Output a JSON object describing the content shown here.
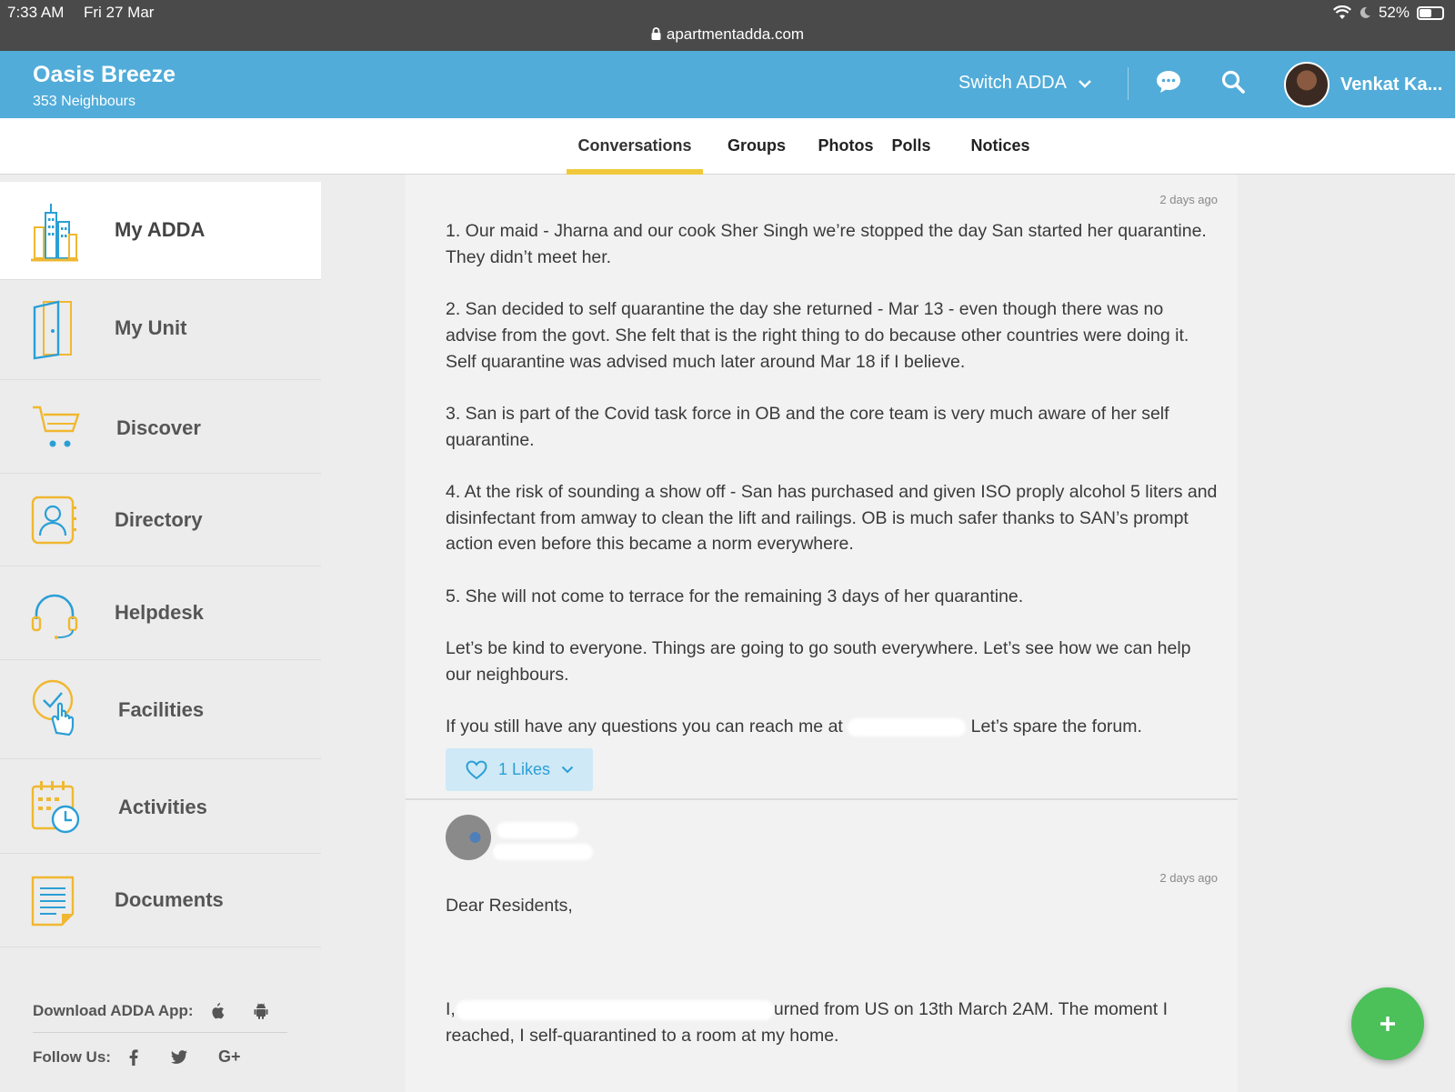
{
  "status_bar": {
    "time": "7:33 AM",
    "date": "Fri 27 Mar",
    "battery": "52%",
    "url": "apartmentadda.com"
  },
  "header": {
    "community_name": "Oasis Breeze",
    "neighbours": "353 Neighbours",
    "switch_label": "Switch ADDA",
    "user_name": "Venkat Ka..."
  },
  "tabs": [
    {
      "label": "Conversations",
      "active": true
    },
    {
      "label": "Groups"
    },
    {
      "label": "Photos"
    },
    {
      "label": "Polls"
    },
    {
      "label": "Notices"
    }
  ],
  "sidebar": {
    "items": [
      {
        "label": "My ADDA",
        "icon": "buildings-icon",
        "active": true
      },
      {
        "label": "My Unit",
        "icon": "door-icon"
      },
      {
        "label": "Discover",
        "icon": "cart-icon"
      },
      {
        "label": "Directory",
        "icon": "contacts-icon"
      },
      {
        "label": "Helpdesk",
        "icon": "headset-icon"
      },
      {
        "label": "Facilities",
        "icon": "hand-pointer-icon"
      },
      {
        "label": "Activities",
        "icon": "calendar-clock-icon"
      },
      {
        "label": "Documents",
        "icon": "document-icon"
      }
    ],
    "download_label": "Download ADDA App:",
    "follow_label": "Follow Us:",
    "google_label": "G+"
  },
  "posts": [
    {
      "timestamp": "2 days ago",
      "paragraphs": [
        "1. Our maid - Jharna and our cook Sher Singh we’re stopped the day San started her quarantine. They didn’t meet her.",
        "2. San decided to self quarantine the day she returned - Mar 13 - even though there was no advise from the govt. She felt that is the right thing to do because other countries were doing it. Self quarantine was advised much later around Mar 18 if I believe.",
        "3. San is part of the Covid task force in OB and the core team is very much aware of her self quarantine.",
        "4. At the risk of sounding a show off - San has purchased and given ISO proply alcohol 5 liters and disinfectant from amway to clean the lift and railings. OB is much safer thanks to SAN’s prompt action even before this became a norm everywhere.",
        "5. She will not come to terrace for the remaining 3 days of her quarantine.",
        "Let’s be kind to everyone. Things are going to go south everywhere. Let’s see how we can help our neighbours."
      ],
      "last_line_start": "If you still have any questions you can reach me at ",
      "last_line_end": " Let’s spare the forum.",
      "likes_label": "1 Likes"
    },
    {
      "timestamp": "2 days ago",
      "greeting": "Dear Residents,",
      "body_start": "I,",
      "body_end": "urned from US on 13th March 2AM. The moment I",
      "body_line2": "reached, I self-quarantined to a room at my home."
    }
  ],
  "colors": {
    "header_blue": "#51acd9",
    "tab_underline": "#f0c93a",
    "like_blue": "#2a9fd6",
    "fab_green": "#4cc15a"
  }
}
